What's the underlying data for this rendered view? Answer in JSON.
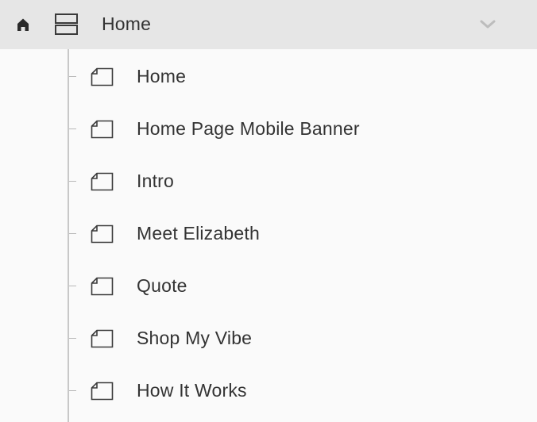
{
  "header": {
    "title": "Home",
    "home_icon": "home-icon",
    "layout_icon": "section-layout-icon",
    "chevron_icon": "chevron-down-icon"
  },
  "sections": [
    {
      "label": "Home",
      "icon": "page-icon"
    },
    {
      "label": "Home Page Mobile Banner",
      "icon": "page-icon"
    },
    {
      "label": "Intro",
      "icon": "page-icon"
    },
    {
      "label": "Meet Elizabeth",
      "icon": "page-icon"
    },
    {
      "label": "Quote",
      "icon": "page-icon"
    },
    {
      "label": "Shop My Vibe",
      "icon": "page-icon"
    },
    {
      "label": "How It Works",
      "icon": "page-icon"
    }
  ],
  "colors": {
    "header_bg": "#e6e6e6",
    "panel_bg": "#fafafa",
    "text": "#333333",
    "tree_line": "#c8c8c8",
    "chevron": "#bdbdbd"
  }
}
